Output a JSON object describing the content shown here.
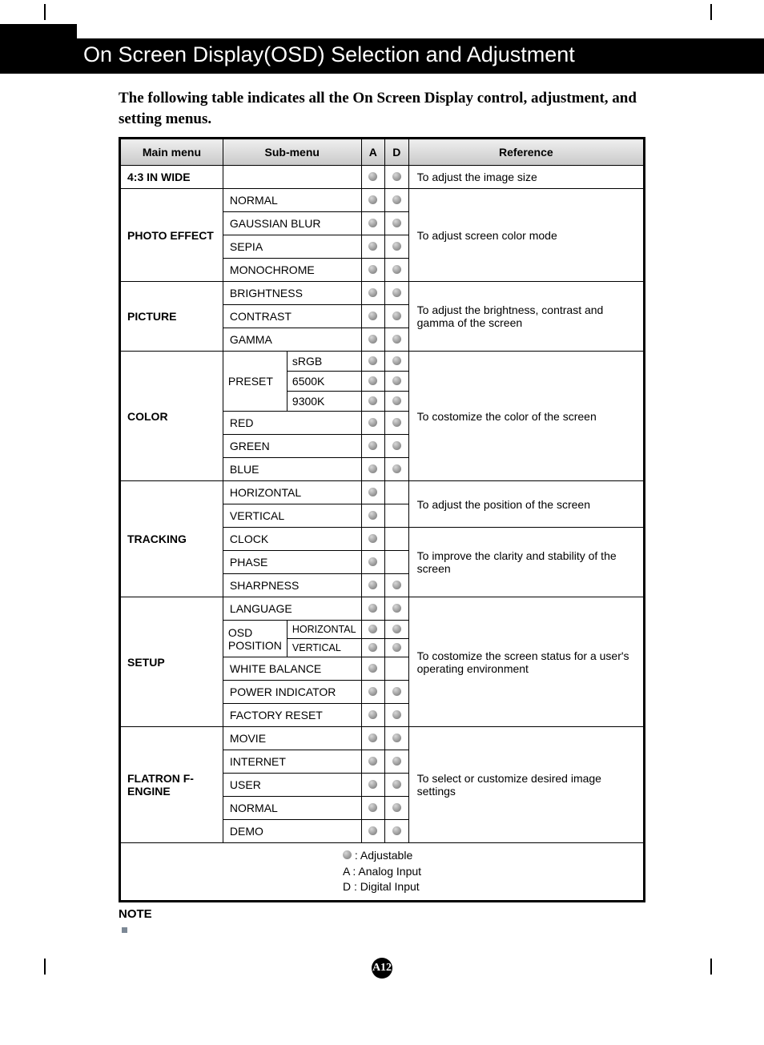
{
  "title": "On Screen Display(OSD) Selection and Adjustment",
  "intro": "The following table indicates all the On Screen Display control, adjustment, and setting menus.",
  "headers": {
    "main": "Main menu",
    "sub": "Sub-menu",
    "a": "A",
    "d": "D",
    "ref": "Reference"
  },
  "rows": {
    "r43": {
      "main": "4:3 IN WIDE",
      "ref": "To adjust the image size"
    },
    "photo": {
      "main": "PHOTO EFFECT",
      "subs": [
        "NORMAL",
        "GAUSSIAN BLUR",
        "SEPIA",
        "MONOCHROME"
      ],
      "ref": "To adjust screen color mode"
    },
    "picture": {
      "main": "PICTURE",
      "subs": [
        "BRIGHTNESS",
        "CONTRAST",
        "GAMMA"
      ],
      "ref": "To adjust the brightness, contrast and gamma of the screen"
    },
    "color": {
      "main": "COLOR",
      "preset": {
        "label": "PRESET",
        "items": [
          "sRGB",
          "6500K",
          "9300K"
        ]
      },
      "subs": [
        "RED",
        "GREEN",
        "BLUE"
      ],
      "ref": "To costomize the color of the screen"
    },
    "tracking": {
      "main": "TRACKING",
      "pos": [
        "HORIZONTAL",
        "VERTICAL"
      ],
      "clk": [
        "CLOCK",
        "PHASE",
        "SHARPNESS"
      ],
      "refPos": "To adjust the position of the screen",
      "refClk": "To improve the clarity and stability of the screen"
    },
    "setup": {
      "main": "SETUP",
      "lang": "LANGUAGE",
      "osd": {
        "label": "OSD POSITION",
        "items": [
          "HORIZONTAL",
          "VERTICAL"
        ]
      },
      "wb": "WHITE BALANCE",
      "pi": "POWER INDICATOR",
      "fr": "FACTORY RESET",
      "ref": "To costomize the screen status for a user's operating environment"
    },
    "fengine": {
      "main": "FLATRON F-ENGINE",
      "subs": [
        "MOVIE",
        "INTERNET",
        "USER",
        "NORMAL",
        "DEMO"
      ],
      "ref": "To select or customize desired image settings"
    }
  },
  "legend": {
    "l1": ": Adjustable",
    "l2": "A : Analog Input",
    "l3": "D : Digital Input"
  },
  "note": "NOTE",
  "pageNum": "A12"
}
